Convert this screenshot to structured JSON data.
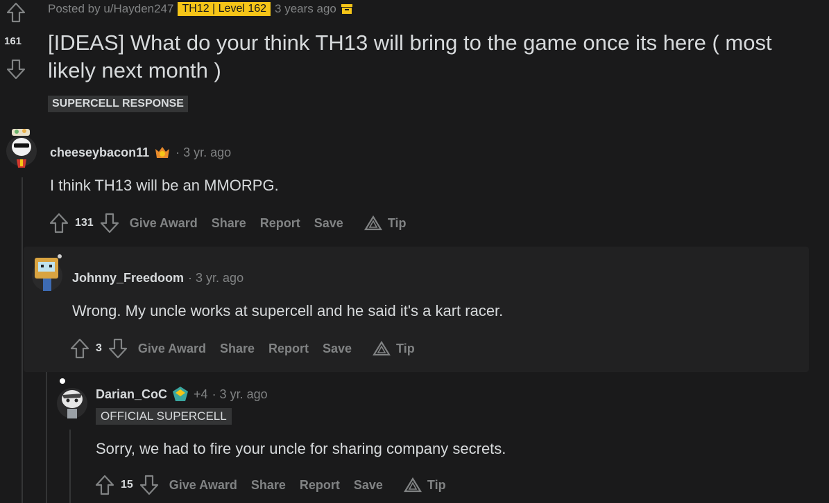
{
  "post": {
    "posted_by": "Posted by u/Hayden247",
    "user_flair": "TH12 | Level 162",
    "age": "3 years ago",
    "score": "161",
    "title": "[IDEAS] What do your think TH13 will bring to the game once its here ( most likely next month )",
    "flair": "SUPERCELL RESPONSE"
  },
  "comments": [
    {
      "author": "cheeseybacon11",
      "age": "· 3 yr. ago",
      "body": "I think TH13 will be an MMORPG.",
      "score": "131"
    },
    {
      "author": "Johnny_Freedoom",
      "age": "· 3 yr. ago",
      "body": "Wrong. My uncle works at supercell and he said it's a kart racer.",
      "score": "3"
    },
    {
      "author": "Darian_CoC",
      "extra": "+4",
      "age": "· 3 yr. ago",
      "flair": "OFFICIAL SUPERCELL",
      "body": "Sorry, we had to fire your uncle for sharing company secrets.",
      "score": "15"
    }
  ],
  "actions": {
    "give_award": "Give Award",
    "share": "Share",
    "report": "Report",
    "save": "Save",
    "tip": "Tip"
  },
  "colors": {
    "background": "#1a1a1b",
    "nested_background": "#212122",
    "text": "#d7dadc",
    "muted": "#818384",
    "flair_yellow": "#f5c518"
  }
}
